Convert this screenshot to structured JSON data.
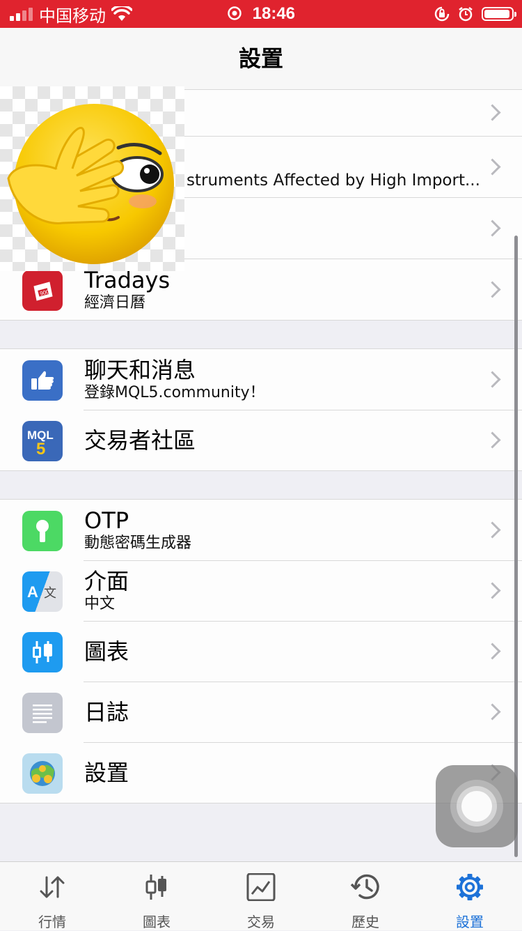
{
  "status_bar": {
    "carrier": "中国移动",
    "time": "18:46"
  },
  "nav": {
    "title": "設置"
  },
  "sections": {
    "top": {
      "news_subtitle": "struments Affected by High Import...",
      "tradays_title": "Tradays",
      "tradays_subtitle": "經濟日曆"
    },
    "community": {
      "chat_title": "聊天和消息",
      "chat_subtitle": "登錄MQL5.community！",
      "traders_title": "交易者社區"
    },
    "tools": {
      "otp_title": "OTP",
      "otp_subtitle": "動態密碼生成器",
      "interface_title": "介面",
      "interface_subtitle": "中文",
      "charts_title": "圖表",
      "journal_title": "日誌",
      "settings_title": "設置"
    }
  },
  "tabbar": {
    "quotes": "行情",
    "charts": "圖表",
    "trade": "交易",
    "history": "歷史",
    "settings": "設置"
  },
  "colors": {
    "status_bar": "#e0232e",
    "accent": "#1d72d8",
    "tradays_icon": "#d0202e",
    "chat_icon": "#3a6fc6",
    "mql5_icon": "#3a68b8",
    "otp_icon": "#4cd964",
    "charts_icon": "#1e9bf0",
    "journal_icon": "#c3c6cf"
  }
}
